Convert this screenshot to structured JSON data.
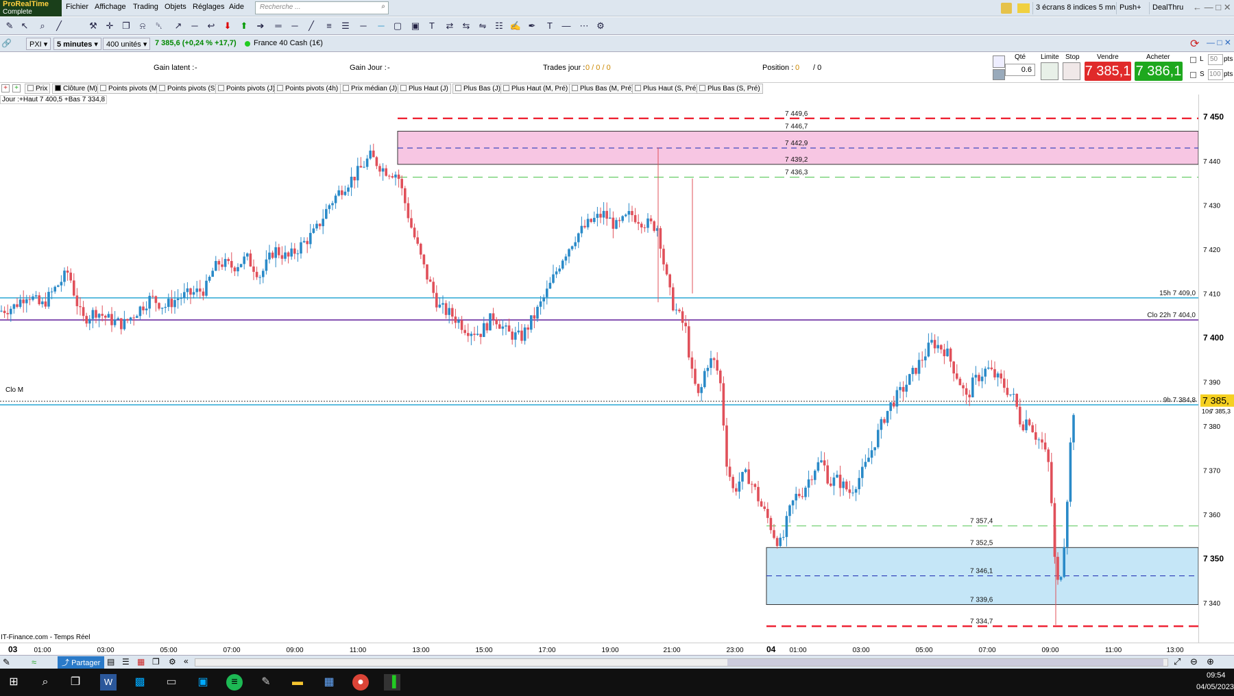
{
  "app": {
    "logo_title": "ProRealTime",
    "logo_edition": "Complete"
  },
  "menu": [
    "Fichier",
    "Affichage",
    "Trading",
    "Objets",
    "Réglages",
    "Aide"
  ],
  "search": {
    "placeholder": "Recherche ..."
  },
  "top_right": {
    "screens": "3 écrans 8 indices 5 mn",
    "push": "Push+",
    "dealthru": "DealThru"
  },
  "toolbar3": {
    "instrument": "PXI",
    "timeframe": "5 minutes",
    "units": "400 unités",
    "quote": "7 385,6 (+0,24 % +17,7)",
    "name": "France 40 Cash (1€)"
  },
  "orderbar": {
    "gain_latent_label": "Gain latent :",
    "gain_latent_value": "-",
    "gain_jour_label": "Gain Jour :",
    "gain_jour_value": "-",
    "trades_label": "Trades jour :",
    "trades_value": "0 / 0 / 0",
    "position_label": "Position :",
    "position_value": "0",
    "position_value2": "/ 0",
    "qty_label": "Qté",
    "qty_value": "0.6",
    "limit_label": "Limite",
    "stop_label": "Stop",
    "sell_label": "Vendre",
    "sell_price": "7 385,1",
    "buy_label": "Acheter",
    "buy_price": "7 386,1",
    "l_label": "L",
    "l_value": "50",
    "s_label": "S",
    "s_value": "100",
    "pts": "pts"
  },
  "legend": [
    "Prix",
    "Clôture (M)",
    "Points pivots (M)",
    "Points pivots (S)",
    "Points pivots (J)",
    "Points pivots (4h)",
    "Prix médian (J)",
    "Plus Haut (J)",
    "Plus Bas (J)",
    "Plus Haut (M, Pré)",
    "Plus Bas (M, Pré)",
    "Plus Haut (S, Pré)",
    "Plus Bas (S, Pré)"
  ],
  "day_info": "Jour :+Haut 7 400,5 +Bas 7 334,8",
  "source": "IT-Finance.com - Temps Réel",
  "clo_m": "Clo M",
  "bottom": {
    "share": "Partager"
  },
  "taskbar": {
    "time": "09:54",
    "date": "04/05/2023"
  },
  "chart_data": {
    "type": "candlestick",
    "instrument": "France 40 Cash (1€)",
    "timeframe": "5 minutes",
    "ylim": [
      7331,
      7455
    ],
    "y_ticks": [
      7340,
      7350,
      7360,
      7370,
      7380,
      7390,
      7400,
      7410,
      7420,
      7430,
      7440,
      7450
    ],
    "y_tick_labels": [
      "7 340",
      "7 350",
      "7 360",
      "7 370",
      "7 380",
      "7 390",
      "7 400",
      "7 410",
      "7 420",
      "7 430",
      "7 440",
      "7 450"
    ],
    "x_labels": [
      "03",
      "01:00",
      "03:00",
      "05:00",
      "07:00",
      "09:00",
      "11:00",
      "13:00",
      "15:00",
      "17:00",
      "19:00",
      "21:00",
      "23:00",
      "04",
      "01:00",
      "03:00",
      "05:00",
      "07:00",
      "09:00",
      "11:00",
      "13:00"
    ],
    "current_price": "7 385,",
    "current_time_label": "10s",
    "current_sub": "7 385,3",
    "horizontal_lines": [
      {
        "label": "15h 7 409,0",
        "value": 7409.0,
        "color": "#3aaed8"
      },
      {
        "label": "Clo 22h 7 404,0",
        "value": 7404.0,
        "color": "#6a2ca0"
      },
      {
        "label": "9h 7 384,8",
        "value": 7384.8,
        "color": "#3aaed8"
      }
    ],
    "zones": [
      {
        "name": "upper",
        "top": 7446.7,
        "bottom": 7439.2,
        "mid": 7442.9,
        "resist": 7449.6,
        "support": 7436.3,
        "color": "#f7c6e3",
        "labels": [
          "7 449,6",
          "7 446,7",
          "7 442,9",
          "7 439,2",
          "7 436,3"
        ]
      },
      {
        "name": "lower",
        "top": 7352.5,
        "bottom": 7339.6,
        "mid": 7346.1,
        "resist": 7357.4,
        "support": 7334.7,
        "color": "#c5e6f7",
        "labels": [
          "7 357,4",
          "7 352,5",
          "7 346,1",
          "7 339,6",
          "7 334,7"
        ]
      }
    ],
    "close_path": [
      [
        0,
        7406
      ],
      [
        20,
        7407
      ],
      [
        40,
        7410
      ],
      [
        60,
        7407
      ],
      [
        80,
        7411
      ],
      [
        100,
        7415
      ],
      [
        110,
        7409
      ],
      [
        120,
        7404
      ],
      [
        140,
        7406
      ],
      [
        160,
        7404
      ],
      [
        180,
        7403
      ],
      [
        200,
        7406
      ],
      [
        220,
        7409
      ],
      [
        240,
        7407
      ],
      [
        260,
        7409
      ],
      [
        280,
        7410
      ],
      [
        300,
        7411
      ],
      [
        310,
        7415
      ],
      [
        320,
        7417
      ],
      [
        340,
        7416
      ],
      [
        360,
        7418
      ],
      [
        380,
        7414
      ],
      [
        400,
        7420
      ],
      [
        420,
        7418
      ],
      [
        440,
        7421
      ],
      [
        460,
        7424
      ],
      [
        480,
        7430
      ],
      [
        500,
        7434
      ],
      [
        520,
        7437
      ],
      [
        540,
        7441
      ],
      [
        560,
        7438
      ],
      [
        580,
        7437
      ],
      [
        600,
        7425
      ],
      [
        620,
        7415
      ],
      [
        640,
        7407
      ],
      [
        660,
        7405
      ],
      [
        680,
        7402
      ],
      [
        700,
        7401
      ],
      [
        720,
        7405
      ],
      [
        740,
        7401
      ],
      [
        760,
        7400
      ],
      [
        780,
        7405
      ],
      [
        800,
        7411
      ],
      [
        820,
        7418
      ],
      [
        840,
        7423
      ],
      [
        860,
        7426
      ],
      [
        880,
        7428
      ],
      [
        900,
        7425
      ],
      [
        920,
        7428
      ],
      [
        940,
        7426
      ],
      [
        960,
        7425
      ],
      [
        970,
        7415
      ],
      [
        980,
        7408
      ],
      [
        1000,
        7402
      ],
      [
        1010,
        7391
      ],
      [
        1020,
        7386
      ],
      [
        1030,
        7394
      ],
      [
        1040,
        7395
      ],
      [
        1050,
        7391
      ],
      [
        1060,
        7372
      ],
      [
        1070,
        7365
      ],
      [
        1080,
        7368
      ],
      [
        1090,
        7369
      ],
      [
        1100,
        7366
      ],
      [
        1110,
        7362
      ],
      [
        1120,
        7359
      ],
      [
        1130,
        7355
      ],
      [
        1140,
        7353
      ],
      [
        1150,
        7360
      ],
      [
        1160,
        7364
      ],
      [
        1170,
        7365
      ],
      [
        1180,
        7368
      ],
      [
        1190,
        7371
      ],
      [
        1200,
        7372
      ],
      [
        1210,
        7367
      ],
      [
        1220,
        7368
      ],
      [
        1240,
        7365
      ],
      [
        1260,
        7370
      ],
      [
        1280,
        7378
      ],
      [
        1290,
        7382
      ],
      [
        1300,
        7385
      ],
      [
        1310,
        7387
      ],
      [
        1320,
        7389
      ],
      [
        1340,
        7394
      ],
      [
        1360,
        7399
      ],
      [
        1380,
        7397
      ],
      [
        1400,
        7390
      ],
      [
        1410,
        7386
      ],
      [
        1420,
        7390
      ],
      [
        1440,
        7393
      ],
      [
        1460,
        7390
      ],
      [
        1480,
        7386
      ],
      [
        1490,
        7380
      ],
      [
        1500,
        7382
      ],
      [
        1510,
        7378
      ],
      [
        1520,
        7376
      ],
      [
        1530,
        7371
      ],
      [
        1535,
        7360
      ],
      [
        1540,
        7345
      ],
      [
        1545,
        7344
      ],
      [
        1550,
        7350
      ],
      [
        1555,
        7359
      ],
      [
        1560,
        7373
      ],
      [
        1565,
        7383
      ],
      [
        1570,
        7386
      ]
    ]
  }
}
